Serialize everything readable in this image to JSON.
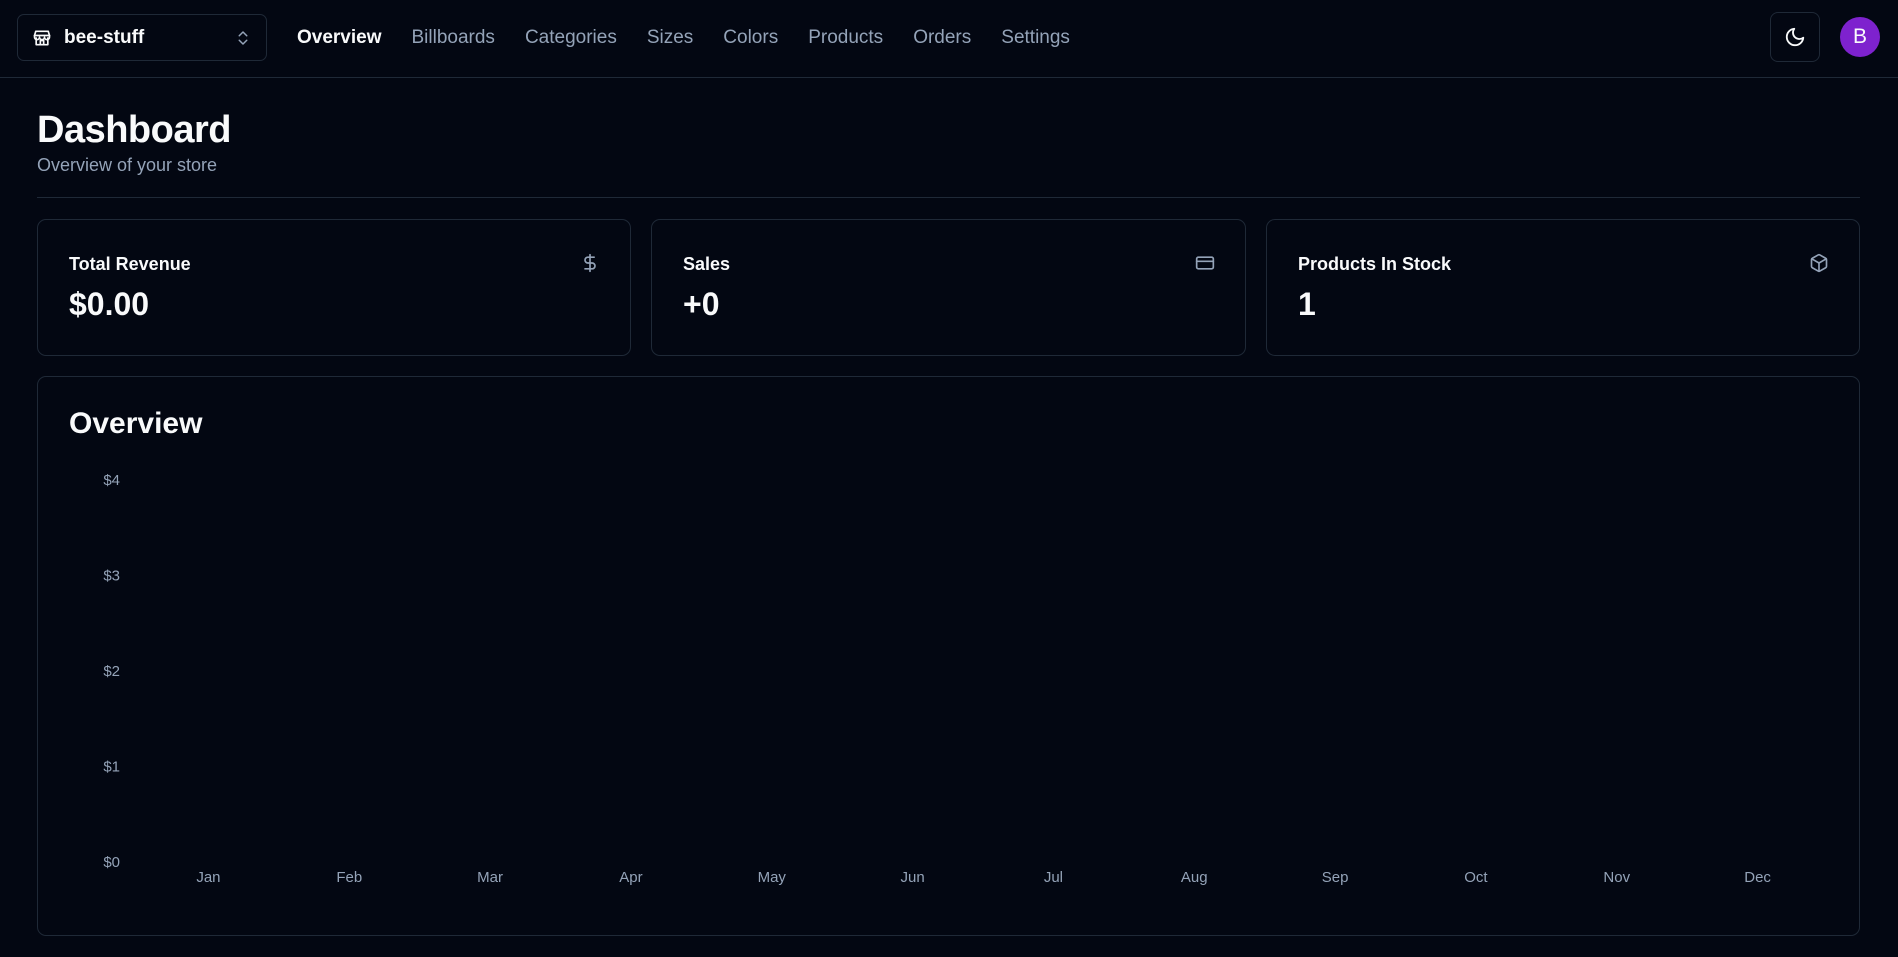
{
  "store_switcher": {
    "name": "bee-stuff",
    "store_icon": "store-icon",
    "chevron_icon": "chevrons-up-down-icon"
  },
  "nav": {
    "items": [
      {
        "label": "Overview",
        "active": true
      },
      {
        "label": "Billboards",
        "active": false
      },
      {
        "label": "Categories",
        "active": false
      },
      {
        "label": "Sizes",
        "active": false
      },
      {
        "label": "Colors",
        "active": false
      },
      {
        "label": "Products",
        "active": false
      },
      {
        "label": "Orders",
        "active": false
      },
      {
        "label": "Settings",
        "active": false
      }
    ]
  },
  "theme_toggle": {
    "icon": "moon-icon"
  },
  "user": {
    "avatar_initial": "B",
    "avatar_color": "#7e22ce"
  },
  "header": {
    "title": "Dashboard",
    "description": "Overview of your store"
  },
  "cards": [
    {
      "title": "Total Revenue",
      "value": "$0.00",
      "icon": "dollar-sign-icon"
    },
    {
      "title": "Sales",
      "value": "+0",
      "icon": "credit-card-icon"
    },
    {
      "title": "Products In Stock",
      "value": "1",
      "icon": "package-icon"
    }
  ],
  "overview": {
    "title": "Overview"
  },
  "colors": {
    "background": "#030712",
    "border": "#1f2937",
    "muted_text": "#94a3b8",
    "text": "#f9fafb"
  },
  "chart_data": {
    "type": "bar",
    "categories": [
      "Jan",
      "Feb",
      "Mar",
      "Apr",
      "May",
      "Jun",
      "Jul",
      "Aug",
      "Sep",
      "Oct",
      "Nov",
      "Dec"
    ],
    "values": [
      0,
      0,
      0,
      0,
      0,
      0,
      0,
      0,
      0,
      0,
      0,
      0
    ],
    "ylim": [
      0,
      4
    ],
    "yticks": [
      "$0",
      "$1",
      "$2",
      "$3",
      "$4"
    ],
    "grid": false
  }
}
